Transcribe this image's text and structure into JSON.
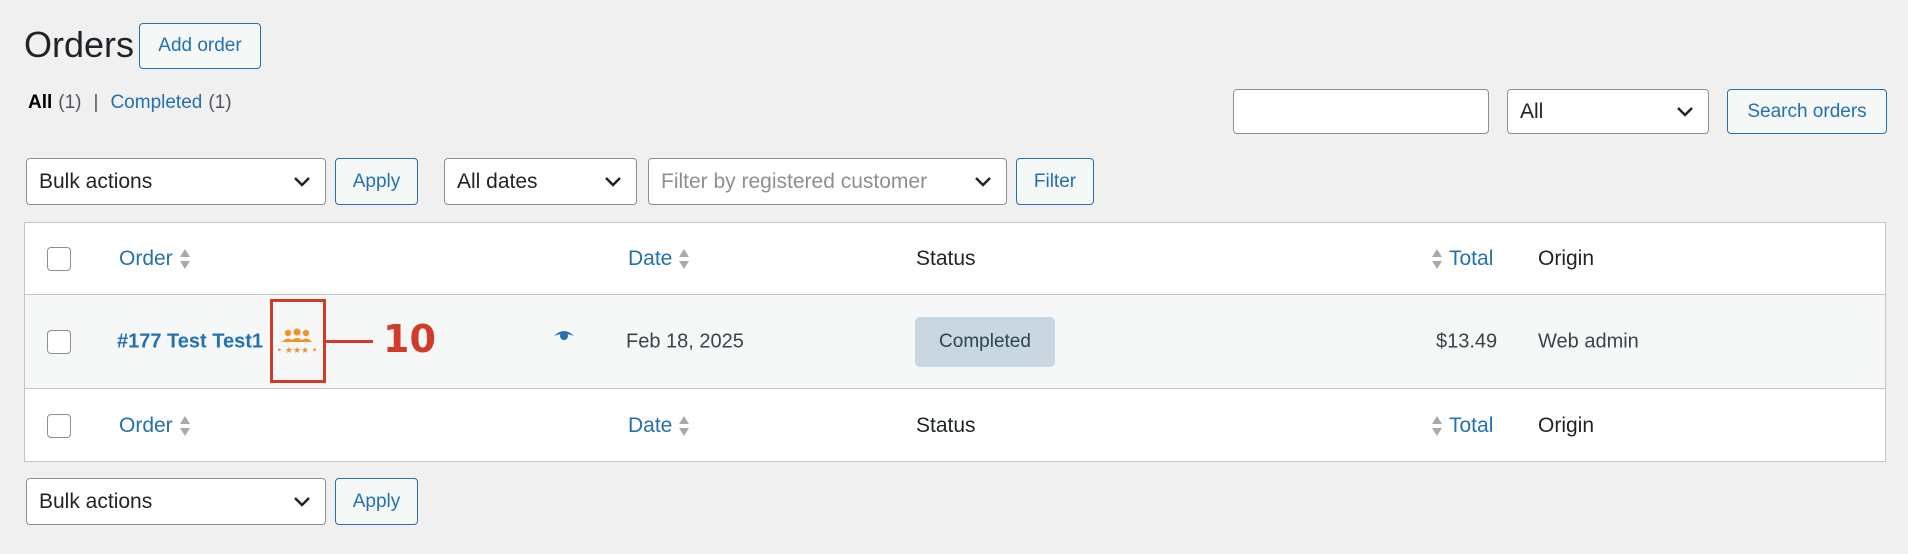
{
  "page": {
    "title": "Orders",
    "add_order_label": "Add order"
  },
  "views": {
    "all_label": "All",
    "all_count": "(1)",
    "separator": "|",
    "completed_label": "Completed",
    "completed_count": "(1)"
  },
  "search": {
    "status_value": "All",
    "button_label": "Search orders"
  },
  "filters": {
    "bulk_actions": "Bulk actions",
    "apply_label": "Apply",
    "dates_value": "All dates",
    "customer_placeholder": "Filter by registered customer",
    "filter_label": "Filter"
  },
  "table": {
    "columns": {
      "order": "Order",
      "date": "Date",
      "status": "Status",
      "total": "Total",
      "origin": "Origin"
    },
    "rows": [
      {
        "order": "#177 Test Test1",
        "date": "Feb 18, 2025",
        "status": "Completed",
        "total": "$13.49",
        "origin": "Web admin"
      }
    ]
  },
  "annotation": {
    "label": "10"
  },
  "colors": {
    "link": "#2271b1",
    "annotation": "#d13b28",
    "badge_bg": "#c8d7e1",
    "icon_orange": "#f0932b"
  },
  "icons": {
    "customer": "group-stars-icon",
    "preview": "eye-icon",
    "sort": "sort-arrows-icon",
    "dropdown": "chevron-down-icon"
  }
}
